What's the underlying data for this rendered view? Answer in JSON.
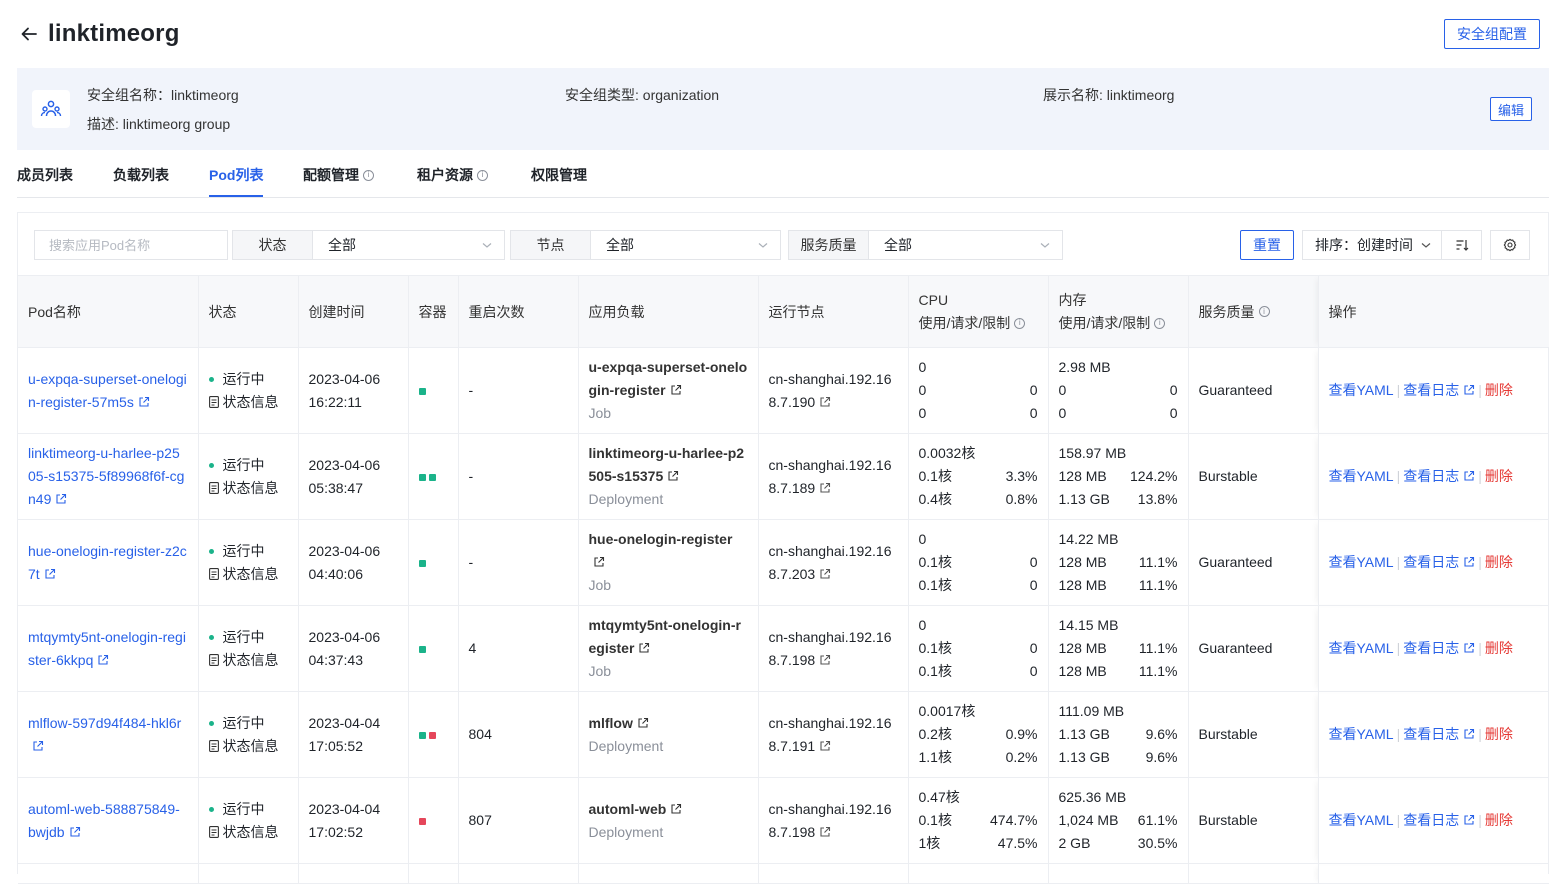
{
  "header": {
    "title": "linktimeorg",
    "config_button": "安全组配置"
  },
  "info": {
    "name": "安全组名称：linktimeorg",
    "type": "安全组类型: organization",
    "display_name": "展示名称: linktimeorg",
    "description": "描述: linktimeorg group",
    "edit_button": "编辑"
  },
  "tabs": [
    {
      "label": "成员列表"
    },
    {
      "label": "负载列表"
    },
    {
      "label": "Pod列表",
      "active": true
    },
    {
      "label": "配额管理"
    },
    {
      "label": "租户资源"
    },
    {
      "label": "权限管理"
    }
  ],
  "filters": {
    "search_placeholder": "搜索应用Pod名称",
    "status_label": "状态",
    "status_value": "全部",
    "node_label": "节点",
    "node_value": "全部",
    "qos_label": "服务质量",
    "qos_value": "全部",
    "reset": "重置",
    "sort_label": "排序：创建时间"
  },
  "columns": {
    "name": "Pod名称",
    "status": "状态",
    "created": "创建时间",
    "containers": "容器",
    "restarts": "重启次数",
    "workload": "应用负载",
    "node": "运行节点",
    "cpu": "CPU",
    "cpu_sub": "使用/请求/限制",
    "mem": "内存",
    "mem_sub": "使用/请求/限制",
    "qos": "服务质量",
    "ops": "操作"
  },
  "common": {
    "running": "运行中",
    "status_info": "状态信息",
    "view_yaml": "查看YAML",
    "view_logs": "查看日志",
    "delete": "删除"
  },
  "colors": {
    "accent": "#2861e8",
    "running": "#1bb38a",
    "error": "#e5465a",
    "danger": "#e53935"
  },
  "pods": [
    {
      "name": "u-expqa-superset-onelogin-register-57m5s",
      "date": "2023-04-06",
      "time": "16:22:11",
      "containers": [
        "green"
      ],
      "restarts": "-",
      "workload": "u-expqa-superset-onelogin-register",
      "kind": "Job",
      "node": "cn-shanghai.192.168.7.190",
      "cpu": [
        "0",
        "0",
        "0"
      ],
      "cpu_pct": [
        "",
        "0",
        "0"
      ],
      "mem": [
        "2.98 MB",
        "0",
        "0"
      ],
      "mem_pct": [
        "",
        "0",
        "0"
      ],
      "qos": "Guaranteed"
    },
    {
      "name": "linktimeorg-u-harlee-p2505-s15375-5f89968f6f-cgn49",
      "date": "2023-04-06",
      "time": "05:38:47",
      "containers": [
        "green",
        "green"
      ],
      "restarts": "-",
      "workload": "linktimeorg-u-harlee-p2505-s15375",
      "kind": "Deployment",
      "node": "cn-shanghai.192.168.7.189",
      "cpu": [
        "0.0032核",
        "0.1核",
        "0.4核"
      ],
      "cpu_pct": [
        "",
        "3.3%",
        "0.8%"
      ],
      "mem": [
        "158.97 MB",
        "128 MB",
        "1.13 GB"
      ],
      "mem_pct": [
        "",
        "124.2%",
        "13.8%"
      ],
      "qos": "Burstable"
    },
    {
      "name": "hue-onelogin-register-z2c7t",
      "date": "2023-04-06",
      "time": "04:40:06",
      "containers": [
        "green"
      ],
      "restarts": "-",
      "workload": "hue-onelogin-register",
      "kind": "Job",
      "node": "cn-shanghai.192.168.7.203",
      "cpu": [
        "0",
        "0.1核",
        "0.1核"
      ],
      "cpu_pct": [
        "",
        "0",
        "0"
      ],
      "mem": [
        "14.22 MB",
        "128 MB",
        "128 MB"
      ],
      "mem_pct": [
        "",
        "11.1%",
        "11.1%"
      ],
      "qos": "Guaranteed"
    },
    {
      "name": "mtqymty5nt-onelogin-register-6kkpq",
      "date": "2023-04-06",
      "time": "04:37:43",
      "containers": [
        "green"
      ],
      "restarts": "4",
      "workload": "mtqymty5nt-onelogin-register",
      "kind": "Job",
      "node": "cn-shanghai.192.168.7.198",
      "cpu": [
        "0",
        "0.1核",
        "0.1核"
      ],
      "cpu_pct": [
        "",
        "0",
        "0"
      ],
      "mem": [
        "14.15 MB",
        "128 MB",
        "128 MB"
      ],
      "mem_pct": [
        "",
        "11.1%",
        "11.1%"
      ],
      "qos": "Guaranteed"
    },
    {
      "name": "mlflow-597d94f484-hkl6r",
      "date": "2023-04-04",
      "time": "17:05:52",
      "containers": [
        "green",
        "red"
      ],
      "restarts": "804",
      "workload": "mlflow",
      "kind": "Deployment",
      "node": "cn-shanghai.192.168.7.191",
      "cpu": [
        "0.0017核",
        "0.2核",
        "1.1核"
      ],
      "cpu_pct": [
        "",
        "0.9%",
        "0.2%"
      ],
      "mem": [
        "111.09 MB",
        "1.13 GB",
        "1.13 GB"
      ],
      "mem_pct": [
        "",
        "9.6%",
        "9.6%"
      ],
      "qos": "Burstable"
    },
    {
      "name": "automl-web-588875849-bwjdb",
      "date": "2023-04-04",
      "time": "17:02:52",
      "containers": [
        "red"
      ],
      "restarts": "807",
      "workload": "automl-web",
      "kind": "Deployment",
      "node": "cn-shanghai.192.168.7.198",
      "cpu": [
        "0.47核",
        "0.1核",
        "1核"
      ],
      "cpu_pct": [
        "",
        "474.7%",
        "47.5%"
      ],
      "mem": [
        "625.36 MB",
        "1,024 MB",
        "2 GB"
      ],
      "mem_pct": [
        "",
        "61.1%",
        "30.5%"
      ],
      "qos": "Burstable"
    }
  ]
}
